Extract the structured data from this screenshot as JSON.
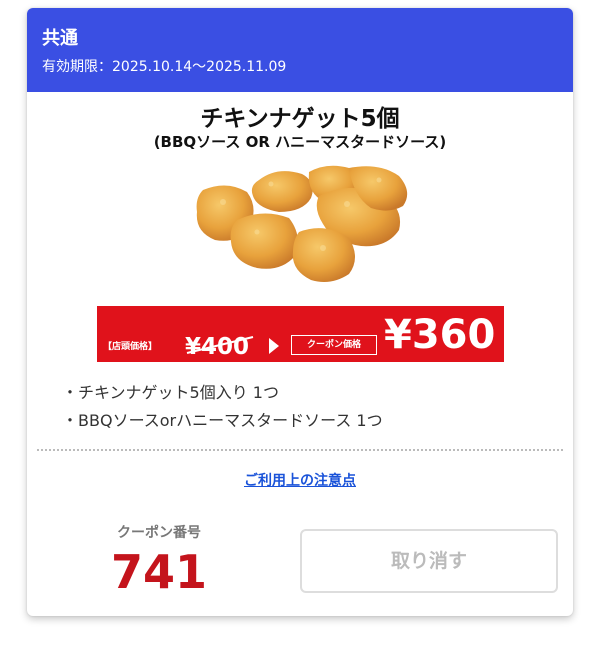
{
  "header": {
    "category": "共通",
    "validity": "有効期限：2025.10.14〜2025.11.09",
    "color": "#3a4fe3"
  },
  "product": {
    "title": "チキンナゲット5個",
    "subtitle": "(BBQソース OR ハニーマスタードソース)",
    "image": "chicken-nuggets"
  },
  "price": {
    "store_label": "【店頭価格】",
    "store_price": "¥400",
    "coupon_label": "クーポン価格",
    "coupon_price": "¥360",
    "banner_color": "#e0121b"
  },
  "items": [
    "チキンナゲット5個入り 1つ",
    "BBQソースorハニーマスタードソース 1つ"
  ],
  "notice_link": "ご利用上の注意点",
  "coupon": {
    "label": "クーポン番号",
    "number": "741",
    "number_color": "#c4141c"
  },
  "cancel_button": "取り消す"
}
